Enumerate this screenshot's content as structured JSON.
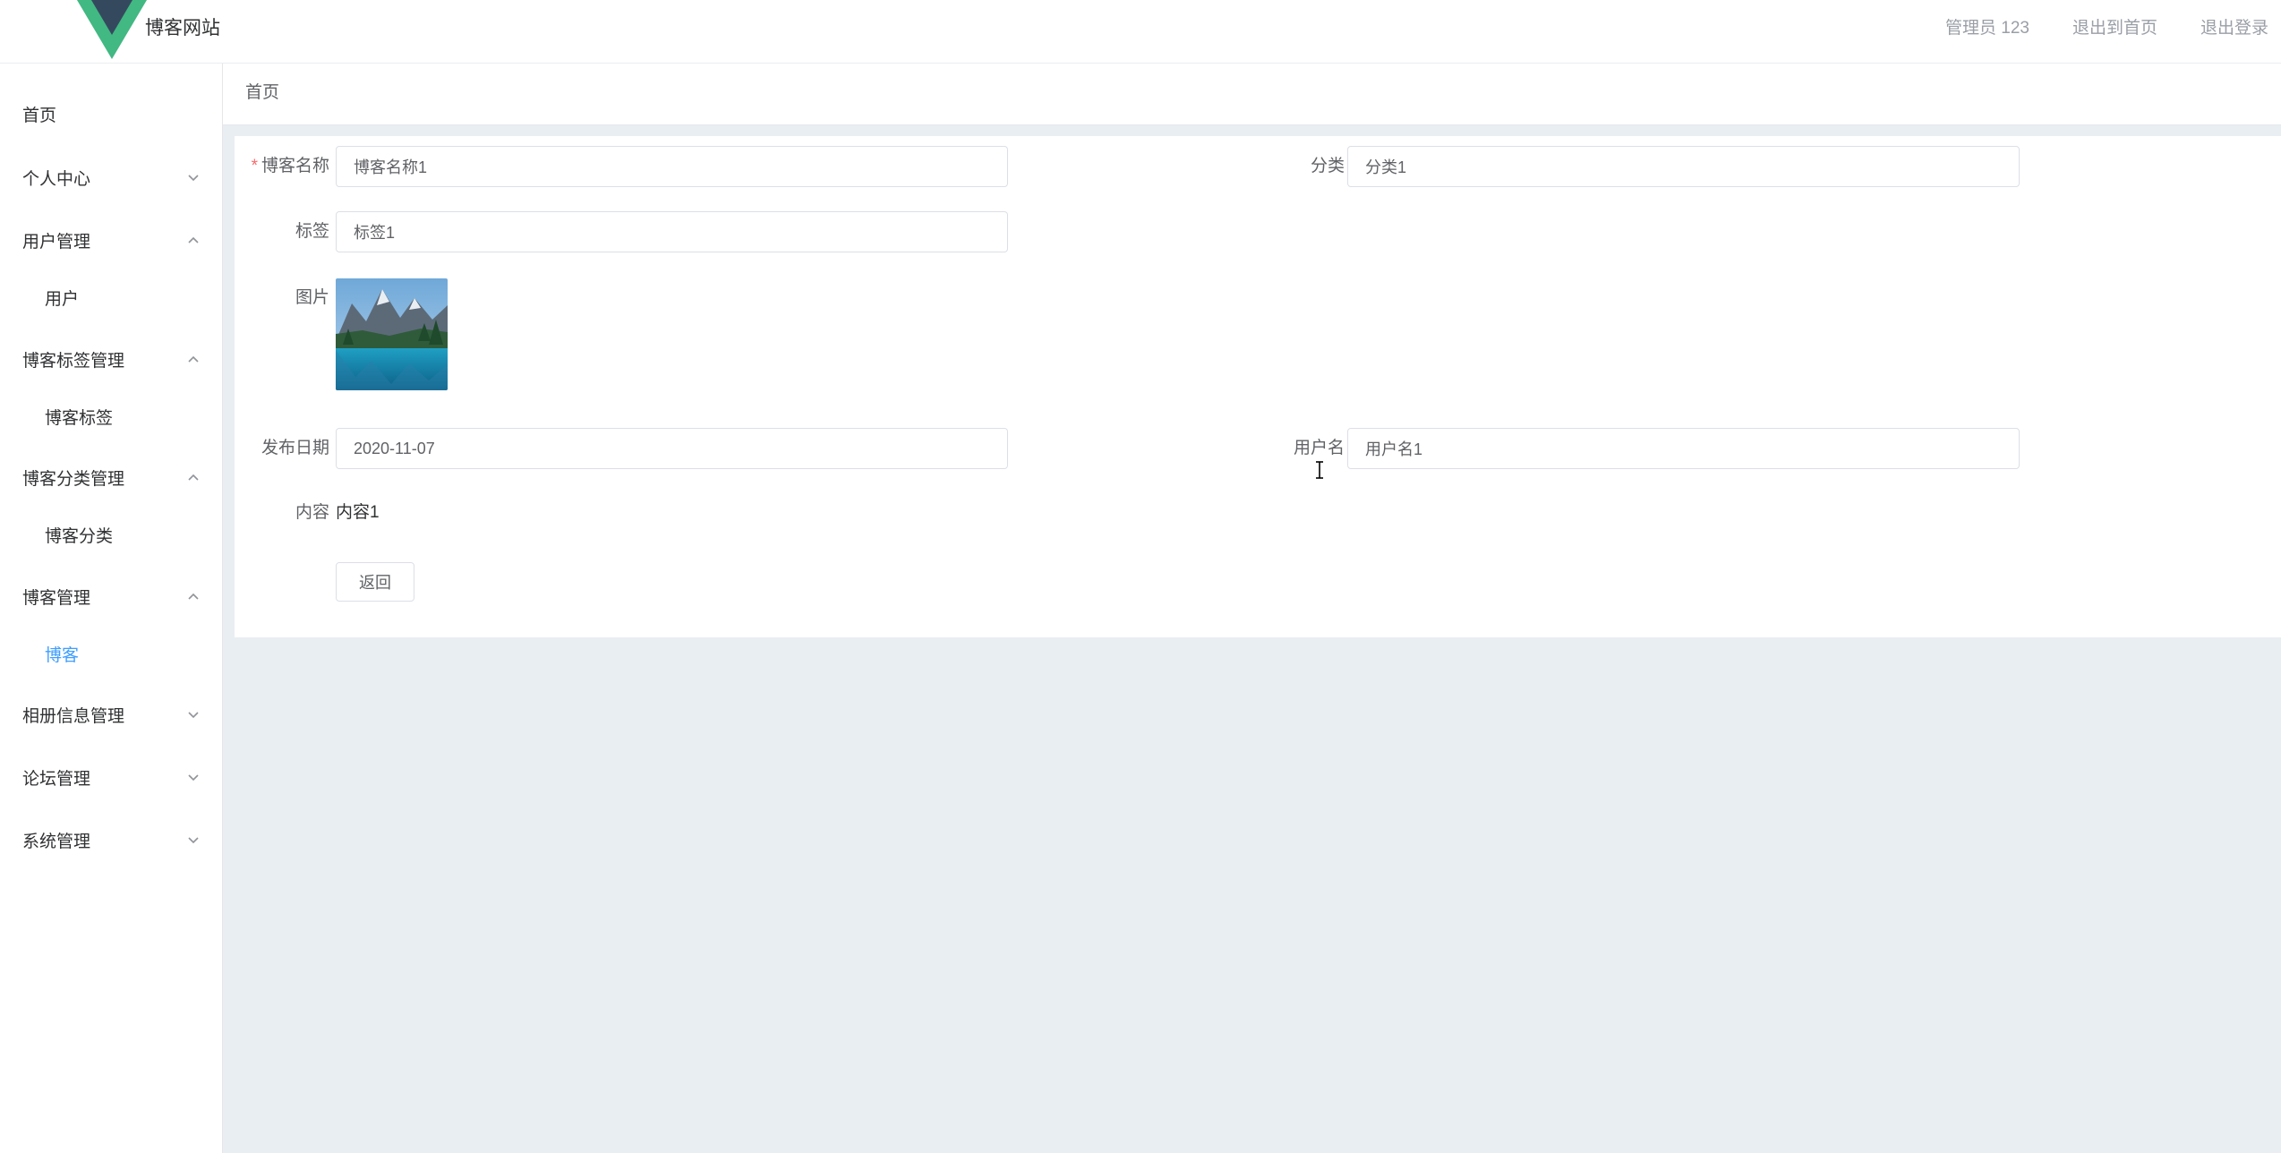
{
  "header": {
    "site_title": "博客网站",
    "user_label": "管理员 123",
    "back_home_label": "退出到首页",
    "logout_label": "退出登录"
  },
  "sidebar": {
    "items": [
      {
        "label": "首页",
        "type": "top",
        "arrow": "none"
      },
      {
        "label": "个人中心",
        "type": "top",
        "arrow": "down"
      },
      {
        "label": "用户管理",
        "type": "top",
        "arrow": "up"
      },
      {
        "label": "用户",
        "type": "sub",
        "arrow": "none"
      },
      {
        "label": "博客标签管理",
        "type": "top",
        "arrow": "up"
      },
      {
        "label": "博客标签",
        "type": "sub",
        "arrow": "none"
      },
      {
        "label": "博客分类管理",
        "type": "top",
        "arrow": "up"
      },
      {
        "label": "博客分类",
        "type": "sub",
        "arrow": "none"
      },
      {
        "label": "博客管理",
        "type": "top",
        "arrow": "up"
      },
      {
        "label": "博客",
        "type": "sub",
        "arrow": "none",
        "active": true
      },
      {
        "label": "相册信息管理",
        "type": "top",
        "arrow": "down"
      },
      {
        "label": "论坛管理",
        "type": "top",
        "arrow": "down"
      },
      {
        "label": "系统管理",
        "type": "top",
        "arrow": "down"
      }
    ]
  },
  "breadcrumb": "首页",
  "form": {
    "blog_name": {
      "label": "博客名称",
      "required": "*",
      "value": "博客名称1"
    },
    "category": {
      "label": "分类",
      "value": "分类1"
    },
    "tag": {
      "label": "标签",
      "value": "标签1"
    },
    "image": {
      "label": "图片"
    },
    "publish_date": {
      "label": "发布日期",
      "value": "2020-11-07"
    },
    "username": {
      "label": "用户名",
      "value": "用户名1"
    },
    "content": {
      "label": "内容",
      "value": "内容1"
    },
    "back_button": "返回"
  },
  "colors": {
    "accent": "#409eff",
    "required": "#f56c6c",
    "main_bg": "#e9eef3",
    "logo_green": "#42b883",
    "logo_dark": "#35495e"
  }
}
